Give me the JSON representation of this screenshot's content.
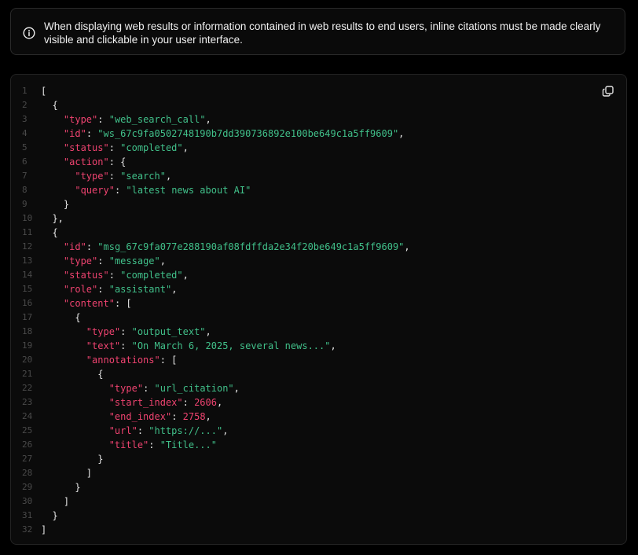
{
  "notice": {
    "text": "When displaying web results or information contained in web results to end users, inline citations must be made clearly visible and clickable in your user interface.",
    "icon": "info-icon"
  },
  "code_block": {
    "copy_icon": "copy-icon",
    "colors": {
      "key": "#ef4370",
      "string": "#41c08a",
      "number": "#ef4370",
      "punctuation": "#e6e6e6",
      "line_number": "#4a4a4a"
    },
    "lines": [
      [
        [
          "p",
          "["
        ]
      ],
      [
        [
          "p",
          "  {"
        ]
      ],
      [
        [
          "p",
          "    "
        ],
        [
          "k",
          "\"type\""
        ],
        [
          "p",
          ": "
        ],
        [
          "s",
          "\"web_search_call\""
        ],
        [
          "p",
          ","
        ]
      ],
      [
        [
          "p",
          "    "
        ],
        [
          "k",
          "\"id\""
        ],
        [
          "p",
          ": "
        ],
        [
          "s",
          "\"ws_67c9fa0502748190b7dd390736892e100be649c1a5ff9609\""
        ],
        [
          "p",
          ","
        ]
      ],
      [
        [
          "p",
          "    "
        ],
        [
          "k",
          "\"status\""
        ],
        [
          "p",
          ": "
        ],
        [
          "s",
          "\"completed\""
        ],
        [
          "p",
          ","
        ]
      ],
      [
        [
          "p",
          "    "
        ],
        [
          "k",
          "\"action\""
        ],
        [
          "p",
          ": {"
        ]
      ],
      [
        [
          "p",
          "      "
        ],
        [
          "k",
          "\"type\""
        ],
        [
          "p",
          ": "
        ],
        [
          "s",
          "\"search\""
        ],
        [
          "p",
          ","
        ]
      ],
      [
        [
          "p",
          "      "
        ],
        [
          "k",
          "\"query\""
        ],
        [
          "p",
          ": "
        ],
        [
          "s",
          "\"latest news about AI\""
        ]
      ],
      [
        [
          "p",
          "    }"
        ]
      ],
      [
        [
          "p",
          "  },"
        ]
      ],
      [
        [
          "p",
          "  {"
        ]
      ],
      [
        [
          "p",
          "    "
        ],
        [
          "k",
          "\"id\""
        ],
        [
          "p",
          ": "
        ],
        [
          "s",
          "\"msg_67c9fa077e288190af08fdffda2e34f20be649c1a5ff9609\""
        ],
        [
          "p",
          ","
        ]
      ],
      [
        [
          "p",
          "    "
        ],
        [
          "k",
          "\"type\""
        ],
        [
          "p",
          ": "
        ],
        [
          "s",
          "\"message\""
        ],
        [
          "p",
          ","
        ]
      ],
      [
        [
          "p",
          "    "
        ],
        [
          "k",
          "\"status\""
        ],
        [
          "p",
          ": "
        ],
        [
          "s",
          "\"completed\""
        ],
        [
          "p",
          ","
        ]
      ],
      [
        [
          "p",
          "    "
        ],
        [
          "k",
          "\"role\""
        ],
        [
          "p",
          ": "
        ],
        [
          "s",
          "\"assistant\""
        ],
        [
          "p",
          ","
        ]
      ],
      [
        [
          "p",
          "    "
        ],
        [
          "k",
          "\"content\""
        ],
        [
          "p",
          ": ["
        ]
      ],
      [
        [
          "p",
          "      {"
        ]
      ],
      [
        [
          "p",
          "        "
        ],
        [
          "k",
          "\"type\""
        ],
        [
          "p",
          ": "
        ],
        [
          "s",
          "\"output_text\""
        ],
        [
          "p",
          ","
        ]
      ],
      [
        [
          "p",
          "        "
        ],
        [
          "k",
          "\"text\""
        ],
        [
          "p",
          ": "
        ],
        [
          "s",
          "\"On March 6, 2025, several news...\""
        ],
        [
          "p",
          ","
        ]
      ],
      [
        [
          "p",
          "        "
        ],
        [
          "k",
          "\"annotations\""
        ],
        [
          "p",
          ": ["
        ]
      ],
      [
        [
          "p",
          "          {"
        ]
      ],
      [
        [
          "p",
          "            "
        ],
        [
          "k",
          "\"type\""
        ],
        [
          "p",
          ": "
        ],
        [
          "s",
          "\"url_citation\""
        ],
        [
          "p",
          ","
        ]
      ],
      [
        [
          "p",
          "            "
        ],
        [
          "k",
          "\"start_index\""
        ],
        [
          "p",
          ": "
        ],
        [
          "n",
          "2606"
        ],
        [
          "p",
          ","
        ]
      ],
      [
        [
          "p",
          "            "
        ],
        [
          "k",
          "\"end_index\""
        ],
        [
          "p",
          ": "
        ],
        [
          "n",
          "2758"
        ],
        [
          "p",
          ","
        ]
      ],
      [
        [
          "p",
          "            "
        ],
        [
          "k",
          "\"url\""
        ],
        [
          "p",
          ": "
        ],
        [
          "s",
          "\"https://...\""
        ],
        [
          "p",
          ","
        ]
      ],
      [
        [
          "p",
          "            "
        ],
        [
          "k",
          "\"title\""
        ],
        [
          "p",
          ": "
        ],
        [
          "s",
          "\"Title...\""
        ]
      ],
      [
        [
          "p",
          "          }"
        ]
      ],
      [
        [
          "p",
          "        ]"
        ]
      ],
      [
        [
          "p",
          "      }"
        ]
      ],
      [
        [
          "p",
          "    ]"
        ]
      ],
      [
        [
          "p",
          "  }"
        ]
      ],
      [
        [
          "p",
          "]"
        ]
      ]
    ]
  }
}
